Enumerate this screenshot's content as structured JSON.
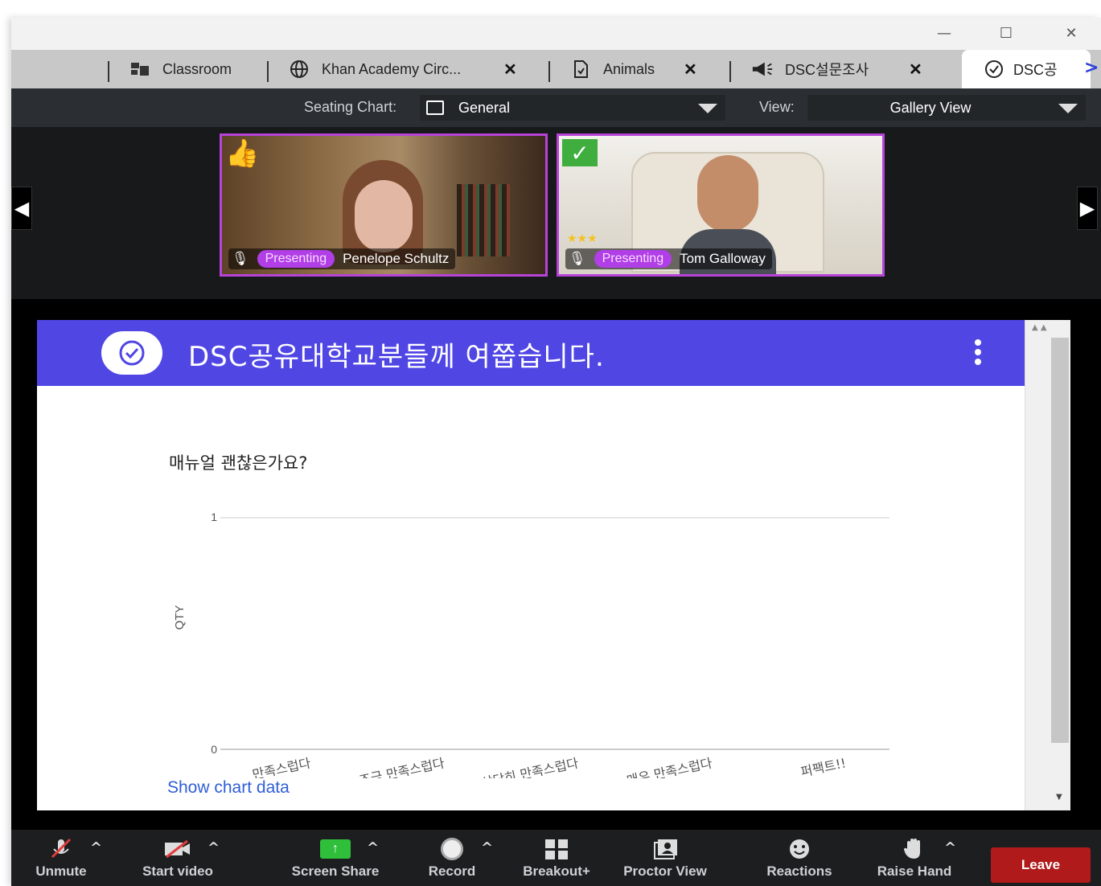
{
  "tabs": [
    {
      "label": "Classroom",
      "icon": "classroom-icon",
      "closable": false
    },
    {
      "label": "Khan Academy Circ...",
      "icon": "globe-icon",
      "closable": true
    },
    {
      "label": "Animals",
      "icon": "document-icon",
      "closable": true
    },
    {
      "label": "DSC설문조사",
      "icon": "megaphone-icon",
      "closable": true
    },
    {
      "label": "DSC공",
      "icon": "check-circle-icon",
      "closable": false,
      "active": true
    }
  ],
  "tab_more": ">",
  "seating": {
    "label": "Seating Chart:",
    "value": "General"
  },
  "view": {
    "label": "View:",
    "value": "Gallery View"
  },
  "participants": [
    {
      "name": "Penelope Schultz",
      "badge": "Presenting",
      "reaction": "thumbs-up-icon"
    },
    {
      "name": "Tom Galloway",
      "badge": "Presenting",
      "reaction": "check-icon"
    }
  ],
  "app": {
    "title": "DSC공유대학교분들께 여쭙습니다.",
    "question": "매뉴얼 괜찮은가요?",
    "show_chart_data": "Show chart data"
  },
  "chart_data": {
    "type": "bar",
    "categories": [
      "만족스럽다",
      "조금 만족스럽다",
      "상당히 만족스럽다",
      "매우 만족스럽다",
      "퍼팩트!!"
    ],
    "values": [
      0,
      0,
      0,
      0,
      0
    ],
    "ylabel": "QTY",
    "ylim": [
      0,
      1
    ],
    "yticks": [
      "0",
      "1"
    ]
  },
  "toolbar": {
    "unmute": "Unmute",
    "start_video": "Start video",
    "screen_share": "Screen Share",
    "record": "Record",
    "breakout": "Breakout+",
    "proctor": "Proctor View",
    "reactions": "Reactions",
    "raise_hand": "Raise Hand",
    "leave": "Leave"
  },
  "colors": {
    "accent": "#5046e4",
    "presenting": "#b13ee6",
    "leave": "#b01a1a"
  }
}
